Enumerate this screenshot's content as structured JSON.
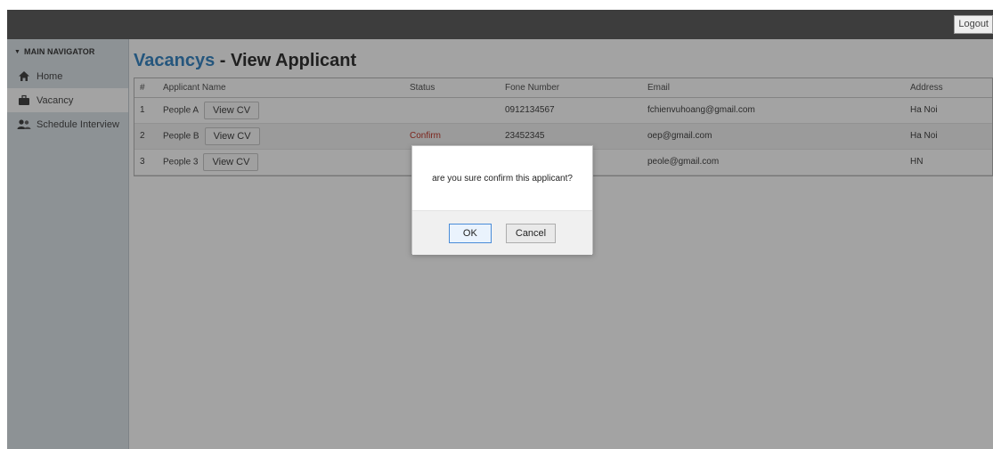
{
  "topbar": {
    "logout_label": "Logout"
  },
  "sidebar": {
    "header": "MAIN NAVIGATOR",
    "items": [
      {
        "label": "Home",
        "icon": "home-icon",
        "active": false
      },
      {
        "label": "Vacancy",
        "icon": "briefcase-icon",
        "active": true
      },
      {
        "label": "Schedule Interview",
        "icon": "users-icon",
        "active": false
      }
    ]
  },
  "main": {
    "title_part1": "Vacancys",
    "title_part2": " - View Applicant",
    "table": {
      "columns": [
        "#",
        "Applicant Name",
        "Status",
        "Fone Number",
        "Email",
        "Address"
      ],
      "view_cv_label": "View CV",
      "rows": [
        {
          "index": "1",
          "name": "People A",
          "status": "",
          "phone": "0912134567",
          "email": "fchienvuhoang@gmail.com",
          "address": "Ha Noi"
        },
        {
          "index": "2",
          "name": "People B",
          "status": "Confirm",
          "phone": "23452345",
          "email": "oep@gmail.com",
          "address": "Ha Noi"
        },
        {
          "index": "3",
          "name": "People 3",
          "status": "",
          "phone": "",
          "email": "peole@gmail.com",
          "address": "HN"
        }
      ]
    }
  },
  "dialog": {
    "message": "are you sure confirm this applicant?",
    "ok_label": "OK",
    "cancel_label": "Cancel"
  },
  "colors": {
    "topbar": "#3d3d3d",
    "accent": "#3a87c4",
    "status_confirm": "#c0392b"
  }
}
